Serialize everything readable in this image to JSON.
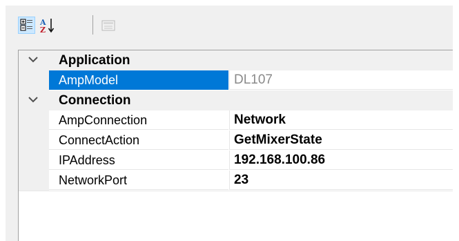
{
  "toolbar": {
    "buttons": [
      {
        "icon": "categorized-icon",
        "state": "active"
      },
      {
        "icon": "alphabetical-sort-icon",
        "state": "normal",
        "glyph_top": "A",
        "glyph_bottom": "Z"
      },
      {
        "icon": "property-pages-icon",
        "state": "disabled"
      }
    ]
  },
  "categories": [
    {
      "label": "Application",
      "properties": [
        {
          "name": "AmpModel",
          "value": "DL107",
          "selected": true,
          "read_only": true
        }
      ]
    },
    {
      "label": "Connection",
      "properties": [
        {
          "name": "AmpConnection",
          "value": "Network"
        },
        {
          "name": "ConnectAction",
          "value": "GetMixerState"
        },
        {
          "name": "IPAddress",
          "value": "192.168.100.86"
        },
        {
          "name": "NetworkPort",
          "value": "23"
        }
      ]
    }
  ],
  "colors": {
    "selection": "#0078d7",
    "category_band": "#f0f0f0",
    "read_only_text": "#8a8a8a"
  }
}
